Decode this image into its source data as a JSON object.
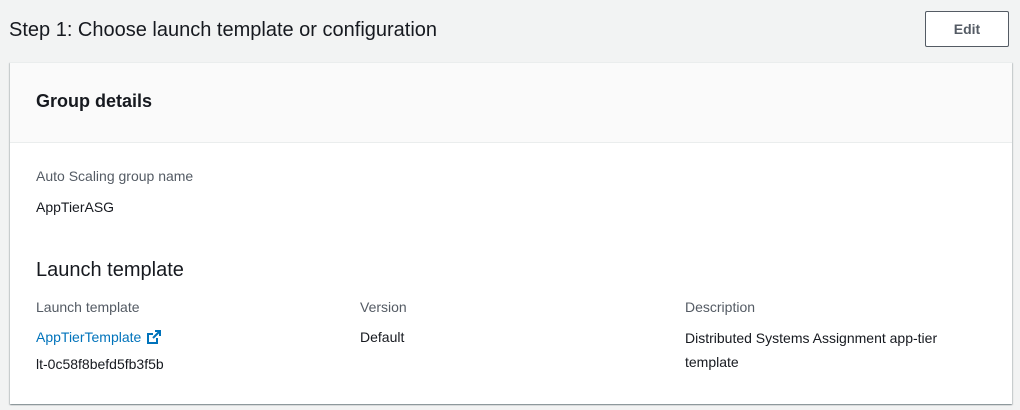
{
  "step": {
    "title": "Step 1: Choose launch template or configuration",
    "edit_label": "Edit"
  },
  "group_details": {
    "header": "Group details",
    "asg_name_label": "Auto Scaling group name",
    "asg_name_value": "AppTierASG"
  },
  "launch_template": {
    "section_title": "Launch template",
    "template_label": "Launch template",
    "template_link": "AppTierTemplate",
    "template_id": "lt-0c58f8befd5fb3f5b",
    "version_label": "Version",
    "version_value": "Default",
    "description_label": "Description",
    "description_value": "Distributed Systems Assignment app-tier template"
  },
  "colors": {
    "link": "#0073bb",
    "page_bg": "#f2f3f3",
    "header_bg": "#fafafa",
    "label": "#545b64"
  },
  "icons": {
    "external_link": "external-link-icon"
  }
}
